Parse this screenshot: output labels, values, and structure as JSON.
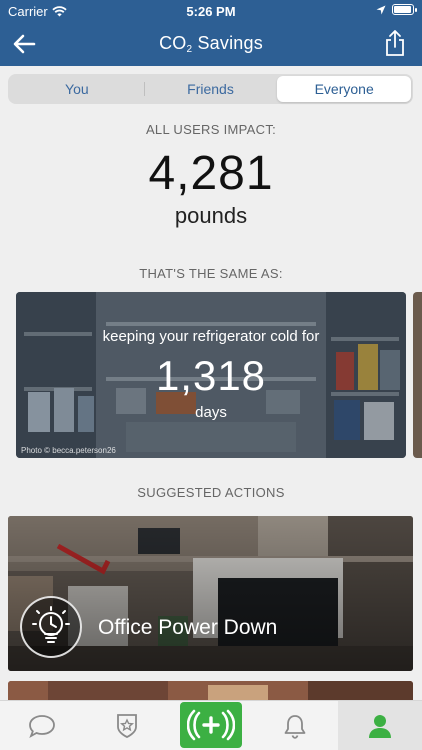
{
  "status_bar": {
    "carrier": "Carrier",
    "time": "5:26 PM"
  },
  "header": {
    "title_prefix": "CO",
    "title_subscript": "2",
    "title_suffix": " Savings",
    "back_icon": "arrow-left-icon",
    "share_icon": "share-icon",
    "background_color": "#2d5f94"
  },
  "segments": {
    "items": [
      {
        "label": "You"
      },
      {
        "label": "Friends"
      },
      {
        "label": "Everyone"
      }
    ],
    "selected": "Everyone"
  },
  "impact": {
    "label": "ALL USERS IMPACT:",
    "value": "4,281",
    "unit": "pounds"
  },
  "equivalence": {
    "section_label": "THAT'S THE SAME AS:",
    "text": "keeping your refrigerator cold for",
    "value": "1,318",
    "unit": "days",
    "photo_credit": "Photo © becca.peterson26"
  },
  "suggested": {
    "section_label": "SUGGESTED ACTIONS",
    "actions": [
      {
        "title": "Office Power Down",
        "icon": "lightbulb-clock-icon"
      }
    ]
  },
  "tabbar": {
    "tabs": [
      {
        "name": "chat",
        "icon": "chat-bubble-icon"
      },
      {
        "name": "badges",
        "icon": "star-shield-icon"
      },
      {
        "name": "add-action",
        "icon": "plus-waves-icon",
        "color": "#3cb043"
      },
      {
        "name": "notifications",
        "icon": "bell-icon"
      },
      {
        "name": "profile",
        "icon": "person-icon",
        "color": "#3cb043",
        "selected": true
      }
    ]
  }
}
